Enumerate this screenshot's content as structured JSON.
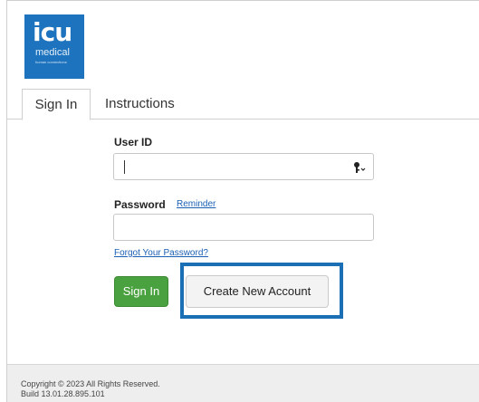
{
  "logo": {
    "main": "icu",
    "sub": "medical",
    "tag": "human connections"
  },
  "tabs": [
    {
      "label": "Sign In",
      "active": true
    },
    {
      "label": "Instructions",
      "active": false
    }
  ],
  "form": {
    "user_id_label": "User ID",
    "user_id_value": "",
    "password_label": "Password",
    "reminder_link": "Reminder",
    "password_value": "",
    "forgot_link": "Forgot Your Password?",
    "signin_button": "Sign In",
    "create_button": "Create New Account"
  },
  "footer": {
    "copyright": "Copyright © 2023   All Rights Reserved.",
    "build": "Build 13.01.28.895.101"
  },
  "colors": {
    "brand": "#1d73bd",
    "signin_green": "#4aa13f",
    "highlight": "#1b6fb5",
    "link": "#1a5fb4"
  },
  "icons": {
    "key": "key-icon"
  }
}
